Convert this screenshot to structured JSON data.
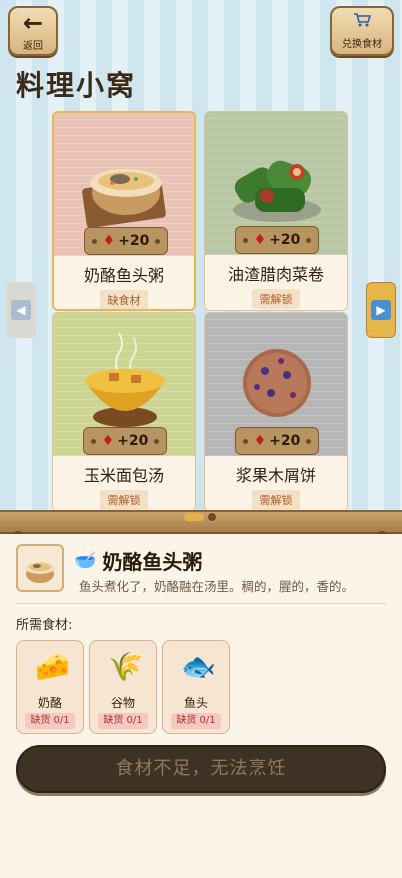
{
  "header": {
    "back_label": "返回",
    "back_icon": "arrow-left-icon",
    "shop_label": "兑换食材",
    "shop_icon": "cart-icon",
    "title": "料理小窝"
  },
  "recipes": [
    {
      "name": "奶酪鱼头粥",
      "status": "缺食材",
      "reward": "+20",
      "bg": "#e9c3b6",
      "selected": true
    },
    {
      "name": "油渣腊肉菜卷",
      "status": "需解锁",
      "reward": "+20",
      "bg": "#b8c7a4",
      "selected": false
    },
    {
      "name": "玉米面包汤",
      "status": "需解锁",
      "reward": "+20",
      "bg": "#cdd592",
      "selected": false
    },
    {
      "name": "浆果木屑饼",
      "status": "需解锁",
      "reward": "+20",
      "bg": "#b6b6b6",
      "selected": false
    }
  ],
  "pager": {
    "total": 2,
    "current": 1
  },
  "detail": {
    "bowl_icon": "🥣",
    "title": "奶酪鱼头粥",
    "description": "鱼头煮化了，奶酪融在汤里。稠的，腥的，香的。",
    "required_label": "所需食材:",
    "ingredients": [
      {
        "name": "奶酪",
        "icon": "🧀",
        "stock": "缺货 0/1"
      },
      {
        "name": "谷物",
        "icon": "🌾",
        "stock": "缺货 0/1"
      },
      {
        "name": "鱼头",
        "icon": "🐟",
        "stock": "缺货 0/1"
      }
    ],
    "cook_button": "食材不足，无法烹饪"
  }
}
